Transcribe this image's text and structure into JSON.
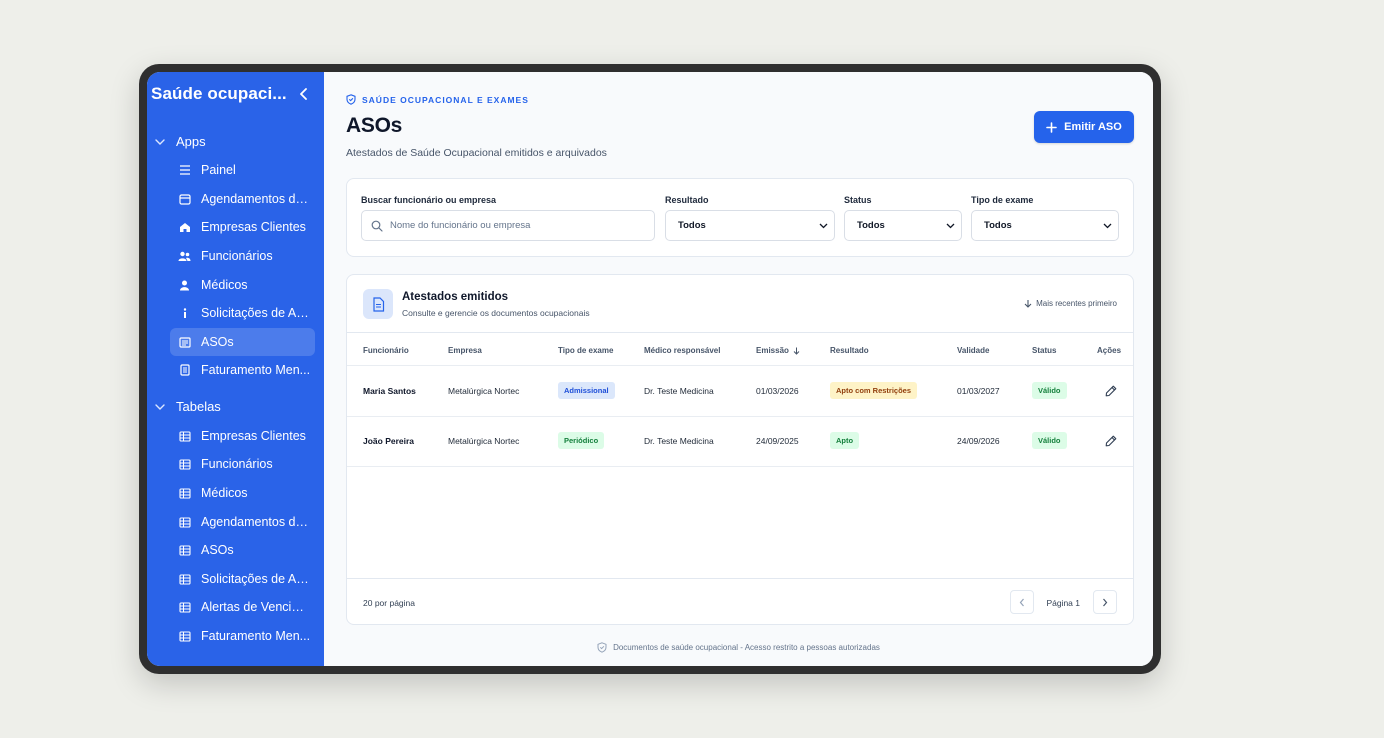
{
  "sidebar": {
    "title": "Saúde ocupaci...",
    "groups": [
      {
        "label": "Apps",
        "items": [
          {
            "label": "Painel",
            "icon": "list-icon"
          },
          {
            "label": "Agendamentos de...",
            "icon": "calendar-icon"
          },
          {
            "label": "Empresas Clientes",
            "icon": "home-icon"
          },
          {
            "label": "Funcionários",
            "icon": "users-icon"
          },
          {
            "label": "Médicos",
            "icon": "user-icon"
          },
          {
            "label": "Solicitações de Ag...",
            "icon": "info-icon"
          },
          {
            "label": "ASOs",
            "icon": "document-icon"
          },
          {
            "label": "Faturamento Men...",
            "icon": "receipt-icon"
          }
        ]
      },
      {
        "label": "Tabelas",
        "items": [
          {
            "label": "Empresas Clientes",
            "icon": "table-icon"
          },
          {
            "label": "Funcionários",
            "icon": "table-icon"
          },
          {
            "label": "Médicos",
            "icon": "table-icon"
          },
          {
            "label": "Agendamentos de...",
            "icon": "table-icon"
          },
          {
            "label": "ASOs",
            "icon": "table-icon"
          },
          {
            "label": "Solicitações de Ag...",
            "icon": "table-icon"
          },
          {
            "label": "Alertas de Vencim...",
            "icon": "table-icon"
          },
          {
            "label": "Faturamento Men...",
            "icon": "table-icon"
          }
        ]
      }
    ]
  },
  "header": {
    "eyebrow": "SAÚDE OCUPACIONAL E EXAMES",
    "title": "ASOs",
    "subtitle": "Atestados de Saúde Ocupacional emitidos e arquivados",
    "primary_action": "Emitir ASO"
  },
  "filters": {
    "search_label": "Buscar funcionário ou empresa",
    "search_placeholder": "Nome do funcionário ou empresa",
    "result_label": "Resultado",
    "result_value": "Todos",
    "status_label": "Status",
    "status_value": "Todos",
    "exam_type_label": "Tipo de exame",
    "exam_type_value": "Todos"
  },
  "table": {
    "title": "Atestados emitidos",
    "subtitle": "Consulte e gerencie os documentos ocupacionais",
    "sort_label": "Mais recentes primeiro",
    "columns": [
      "Funcionário",
      "Empresa",
      "Tipo de exame",
      "Médico responsável",
      "Emissão",
      "Resultado",
      "Validade",
      "Status",
      "Ações"
    ],
    "rows": [
      {
        "employee": "Maria Santos",
        "company": "Metalúrgica Nortec",
        "exam_type": "Admissional",
        "doctor": "Dr. Teste Medicina",
        "issued": "01/03/2026",
        "result": "Apto com Restrições",
        "valid_until": "01/03/2027",
        "status": "Válido"
      },
      {
        "employee": "João Pereira",
        "company": "Metalúrgica Nortec",
        "exam_type": "Periódico",
        "doctor": "Dr. Teste Medicina",
        "issued": "24/09/2025",
        "result": "Apto",
        "valid_until": "24/09/2026",
        "status": "Válido"
      }
    ],
    "per_page": "20 por página",
    "page_label": "Página 1"
  },
  "footer_note": "Documentos de saúde ocupacional - Acesso restrito a pessoas autorizadas",
  "colors": {
    "sidebar_bg": "#2a63e8",
    "primary": "#2563eb",
    "badge_blue": "#dbe7fb",
    "badge_green": "#dcfce7",
    "badge_amber": "#fef3c7"
  }
}
